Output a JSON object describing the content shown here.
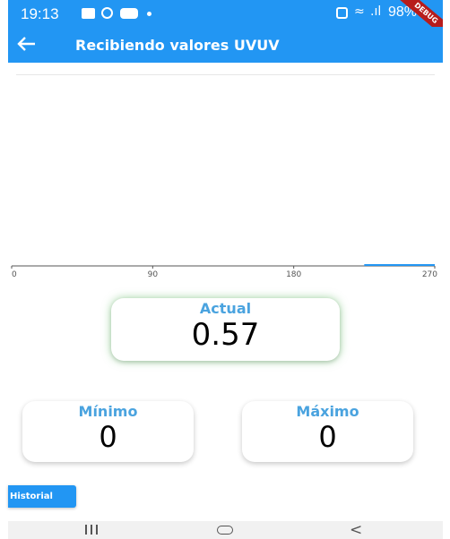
{
  "status_bar": {
    "time": "19:13",
    "battery": "98%",
    "debug_label": "DEBUG",
    "icons": [
      "gallery-icon",
      "pinterest-icon",
      "youtube-icon",
      "dot-icon",
      "alarm-icon",
      "wifi-icon",
      "signal-icon",
      "battery-icon"
    ]
  },
  "app_bar": {
    "title": "Recibiendo valores UVUV",
    "back_icon": "arrow-left-icon",
    "color": "#2296f3"
  },
  "chart_data": {
    "type": "line",
    "x_ticks": [
      "0",
      "90",
      "180",
      "270"
    ],
    "xlim": [
      0,
      270
    ],
    "series": [
      {
        "x": [
          225,
          270
        ],
        "values": [
          0,
          0
        ]
      }
    ],
    "line_color": "#2296f3"
  },
  "cards": {
    "actual": {
      "label": "Actual",
      "value": "0.57"
    },
    "minimo": {
      "label": "Mínimo",
      "value": "0"
    },
    "maximo": {
      "label": "Máximo",
      "value": "0"
    },
    "label_color": "#4aa3df",
    "glow_color": "#4caf50"
  },
  "historial_button": {
    "label": "Historial"
  },
  "nav_bar": {
    "icons": [
      "recents-icon",
      "home-icon",
      "back-icon"
    ],
    "back_glyph": "<"
  }
}
